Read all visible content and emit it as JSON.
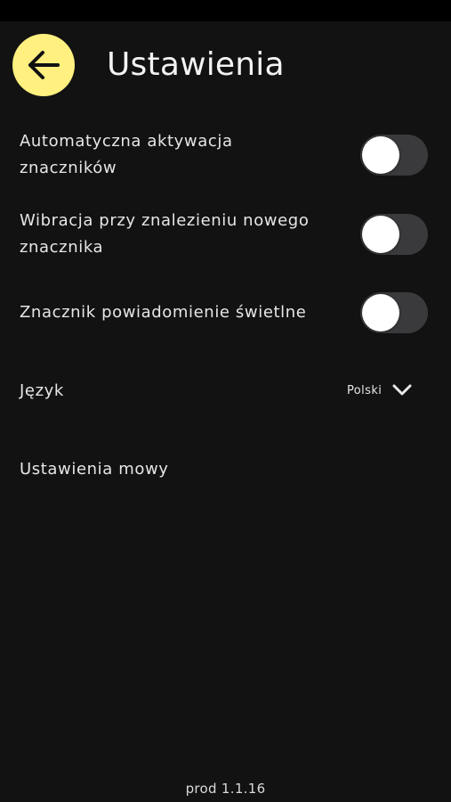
{
  "header": {
    "title": "Ustawienia",
    "back_icon": "arrow-left-icon",
    "back_color": "#fff07f"
  },
  "settings": {
    "auto_activation": {
      "label_line1": "Automatyczna aktywacja",
      "label_line2": "znaczników",
      "enabled": false
    },
    "vibration": {
      "label_line1": "Wibracja przy znalezieniu nowego",
      "label_line2": "znacznika",
      "enabled": false
    },
    "light_notification": {
      "label": "Znacznik powiadomienie świetlne",
      "enabled": false
    },
    "language": {
      "label": "Język",
      "value": "Polski",
      "icon": "chevron-down-icon"
    },
    "speech": {
      "label": "Ustawienia mowy"
    }
  },
  "footer": {
    "version": "prod 1.1.16"
  },
  "colors": {
    "background": "#121212",
    "toggle_off": "#3a3a3c",
    "knob": "#ffffff"
  }
}
